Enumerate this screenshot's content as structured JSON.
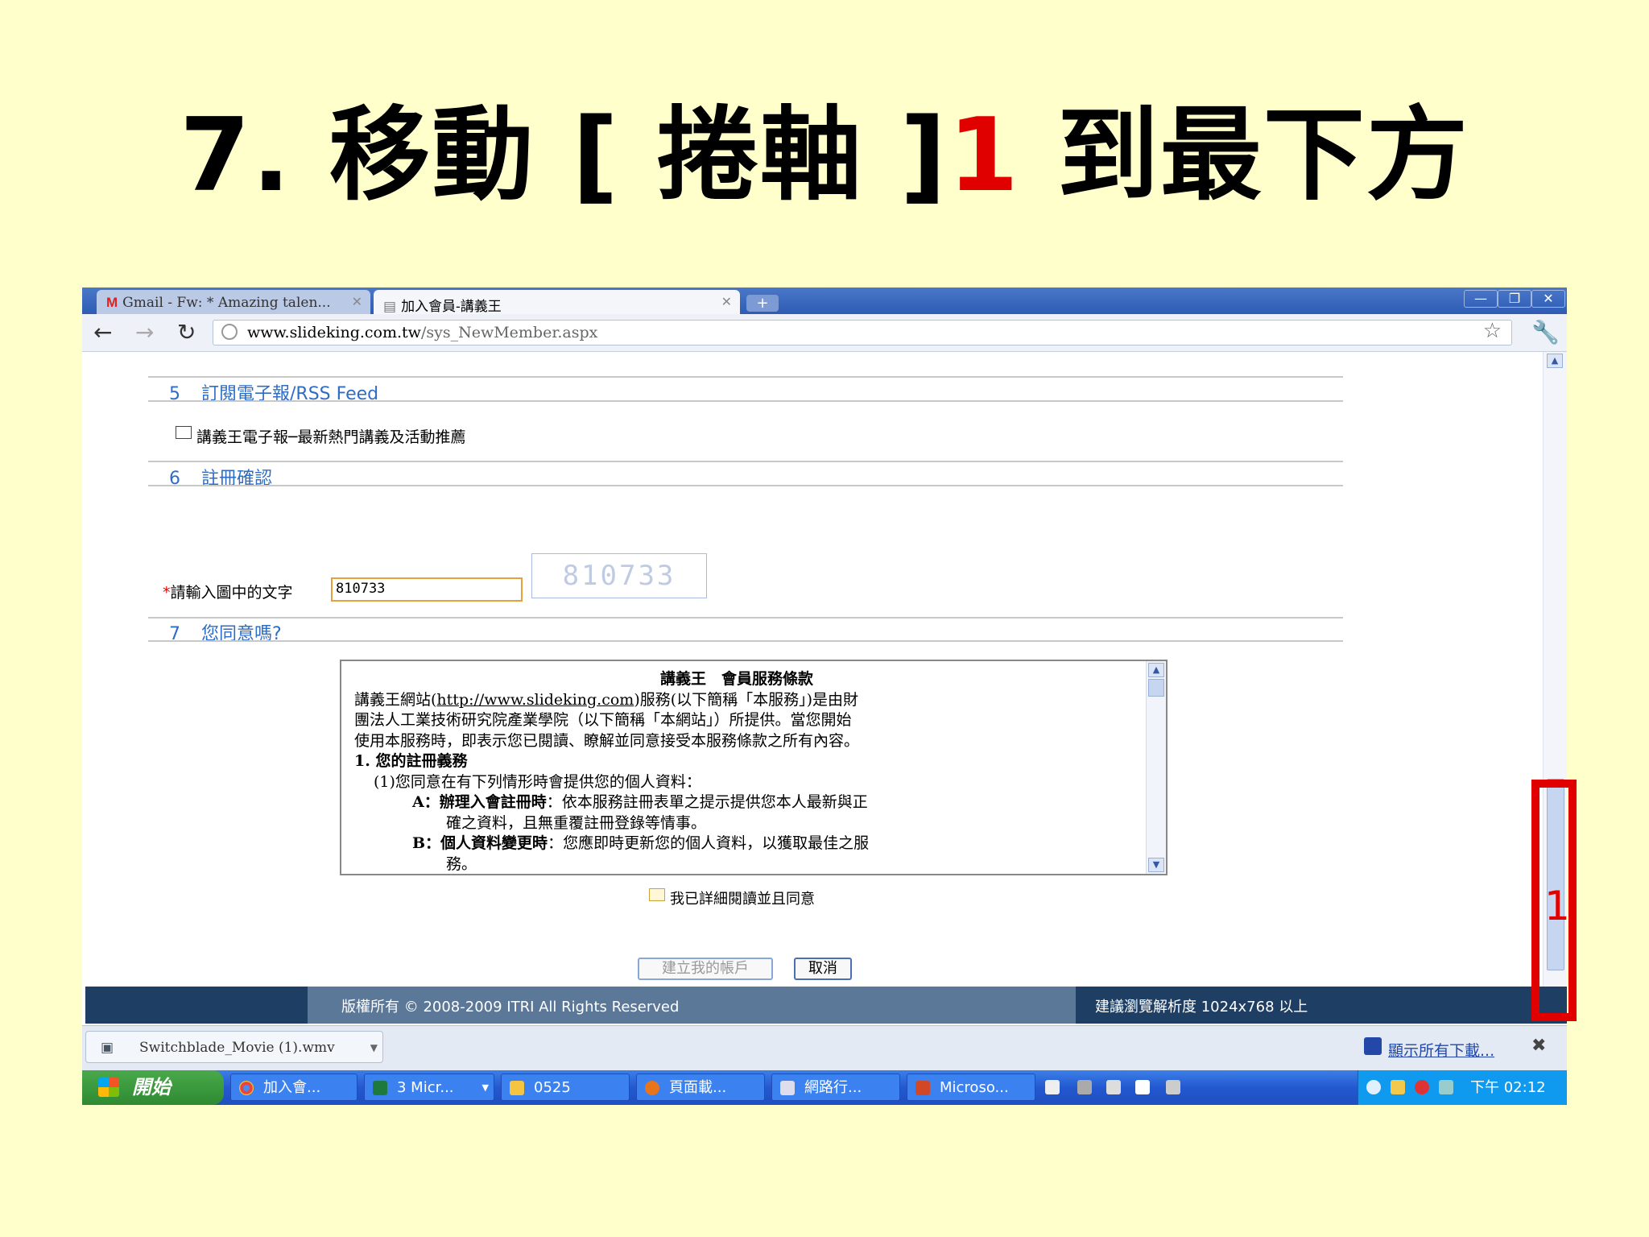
{
  "slide": {
    "title_prefix": "7. 移動 [ 捲軸 ]",
    "title_num": "1",
    "title_suffix": " 到最下方",
    "annotation_number": "1"
  },
  "browser": {
    "tabs": [
      {
        "label": "Gmail - Fw: * Amazing talen...",
        "active": false,
        "icon": "gmail-icon"
      },
      {
        "label": "加入會員-講義王",
        "active": true,
        "icon": "page-icon"
      }
    ],
    "new_tab_label": "+",
    "url_host": "www.slideking.com.tw",
    "url_path": "/sys_NewMember.aspx",
    "window_controls": [
      "—",
      "❐",
      "✕"
    ]
  },
  "page": {
    "sections": [
      {
        "num": "5",
        "title": "訂閱電子報/RSS Feed"
      },
      {
        "num": "6",
        "title": "註冊確認"
      },
      {
        "num": "7",
        "title": "您同意嗎?"
      }
    ],
    "newsletter_label": "講義王電子報─最新熱門講義及活動推薦",
    "captcha_required_mark": "*",
    "captcha_label": "請輸入圖中的文字",
    "captcha_value": "810733",
    "captcha_image_text": "810733",
    "terms": {
      "title": "講義王　會員服務條款",
      "line1a": "講義王網站(",
      "line1_link": "http://www.slideking.com",
      "line1b": ")服務(以下簡稱「本服務」)是由財",
      "line2": "團法人工業技術研究院產業學院（以下簡稱「本網站」）所提供。當您開始",
      "line3": "使用本服務時，即表示您已閱讀、瞭解並同意接受本服務條款之所有內容。",
      "section1": "1. 您的註冊義務",
      "item1": "(1)您同意在有下列情形時會提供您的個人資料：",
      "a_label": "A：辦理入會註冊時",
      "a_text": "：依本服務註冊表單之提示提供您本人最新與正",
      "a_text2": "確之資料，且無重覆註冊登錄等情事。",
      "b_label": "B：個人資料變更時",
      "b_text": "：您應即時更新您的個人資料，以獲取最佳之服",
      "b_text2": "務。"
    },
    "agree_label": "我已詳細閱讀並且同意",
    "create_button": "建立我的帳戶",
    "cancel_button": "取消",
    "footer_copyright": "版權所有 © 2008-2009 ITRI All Rights Reserved",
    "footer_resolution": "建議瀏覽解析度 1024x768 以上",
    "scroll_position": 1.0
  },
  "downloads": {
    "item": "Switchblade_Movie (1).wmv",
    "show_all": "顯示所有下載...",
    "close": "✖"
  },
  "taskbar": {
    "start": "開始",
    "tasks": [
      {
        "label": "加入會...",
        "icon": "chrome-icon"
      },
      {
        "label": "3 Micr...",
        "icon": "excel-icon"
      },
      {
        "label": "0525",
        "icon": "folder-icon"
      },
      {
        "label": "頁面載...",
        "icon": "firefox-icon"
      },
      {
        "label": "網路行...",
        "icon": "window-icon"
      },
      {
        "label": "Microso...",
        "icon": "powerpoint-icon"
      }
    ],
    "clock": "下午 02:12"
  },
  "colors": {
    "slide_bg": "#FFFFCC",
    "accent_red": "#E00000",
    "section_blue": "#2E6DC4",
    "footer_dark": "#1F3E63"
  }
}
